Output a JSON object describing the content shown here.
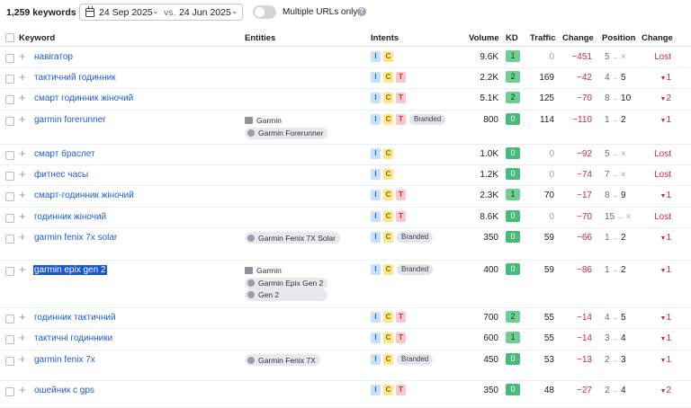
{
  "toolbar": {
    "keyword_count": "1,259 keywords",
    "date_from": "24 Sep 2025",
    "vs": "vs.",
    "date_to": "24 Jun 2025",
    "toggle_label": "Multiple URLs only",
    "help": "?"
  },
  "columns": {
    "keyword": "Keyword",
    "entities": "Entities",
    "intents": "Intents",
    "volume": "Volume",
    "kd": "KD",
    "traffic": "Traffic",
    "change": "Change",
    "position": "Position",
    "pos_change": "Change"
  },
  "rows": [
    {
      "keyword": "навігатор",
      "entities": [],
      "intents": [
        "I",
        "C"
      ],
      "branded": "",
      "volume": "9.6K",
      "kd": "1",
      "traffic": "0",
      "change": "−451",
      "pos_from": "5",
      "pos_to": "×",
      "pos_change": "Lost"
    },
    {
      "keyword": "тактичний годинник",
      "entities": [],
      "intents": [
        "I",
        "C",
        "T"
      ],
      "branded": "",
      "volume": "2.2K",
      "kd": "2",
      "traffic": "169",
      "change": "−42",
      "pos_from": "4",
      "pos_to": "5",
      "pos_change": "1"
    },
    {
      "keyword": "смарт годинник жіночий",
      "entities": [],
      "intents": [
        "I",
        "C",
        "T"
      ],
      "branded": "",
      "volume": "5.1K",
      "kd": "2",
      "traffic": "125",
      "change": "−70",
      "pos_from": "8",
      "pos_to": "10",
      "pos_change": "2"
    },
    {
      "keyword": "garmin forerunner",
      "entities": [
        {
          "icon": "org",
          "label": "Garmin"
        },
        {
          "icon": "gen",
          "label": "Garmin Forerunner",
          "chip": true
        }
      ],
      "intents": [
        "I",
        "C",
        "T"
      ],
      "branded": "Branded",
      "volume": "800",
      "kd": "0",
      "traffic": "114",
      "change": "−110",
      "pos_from": "1",
      "pos_to": "2",
      "pos_change": "1"
    },
    {
      "keyword": "смарт браслет",
      "entities": [],
      "intents": [
        "I",
        "C"
      ],
      "branded": "",
      "volume": "1.0K",
      "kd": "0",
      "traffic": "0",
      "change": "−92",
      "pos_from": "5",
      "pos_to": "×",
      "pos_change": "Lost"
    },
    {
      "keyword": "фитнес часы",
      "entities": [],
      "intents": [
        "I",
        "C"
      ],
      "branded": "",
      "volume": "1.2K",
      "kd": "0",
      "traffic": "0",
      "change": "−74",
      "pos_from": "7",
      "pos_to": "×",
      "pos_change": "Lost"
    },
    {
      "keyword": "смарт-годинник жіночий",
      "entities": [],
      "intents": [
        "I",
        "C",
        "T"
      ],
      "branded": "",
      "volume": "2.3K",
      "kd": "1",
      "traffic": "70",
      "change": "−17",
      "pos_from": "8",
      "pos_to": "9",
      "pos_change": "1"
    },
    {
      "keyword": "годинник жіночий",
      "entities": [],
      "intents": [
        "I",
        "C",
        "T"
      ],
      "branded": "",
      "volume": "8.6K",
      "kd": "0",
      "traffic": "0",
      "change": "−70",
      "pos_from": "15",
      "pos_to": "×",
      "pos_change": "Lost"
    },
    {
      "keyword": "garmin fenix 7x solar",
      "entities": [
        {
          "icon": "gen",
          "label": "Garmin Fenix 7X Solar",
          "chip": true
        }
      ],
      "intents": [
        "I",
        "C"
      ],
      "branded": "Branded",
      "volume": "350",
      "kd": "0",
      "traffic": "59",
      "change": "−66",
      "pos_from": "1",
      "pos_to": "2",
      "pos_change": "1"
    },
    {
      "keyword": "garmin epix gen 2",
      "selected": true,
      "entities": [
        {
          "icon": "org",
          "label": "Garmin"
        },
        {
          "icon": "gen",
          "label": "Garmin Epix Gen 2",
          "chip": true
        },
        {
          "icon": "gen",
          "label": "Gen 2",
          "chip": true
        }
      ],
      "intents": [
        "I",
        "C"
      ],
      "branded": "Branded",
      "volume": "400",
      "kd": "0",
      "traffic": "59",
      "change": "−86",
      "pos_from": "1",
      "pos_to": "2",
      "pos_change": "1"
    },
    {
      "keyword": "годинник тактичний",
      "entities": [],
      "intents": [
        "I",
        "C",
        "T"
      ],
      "branded": "",
      "volume": "700",
      "kd": "2",
      "traffic": "55",
      "change": "−14",
      "pos_from": "4",
      "pos_to": "5",
      "pos_change": "1"
    },
    {
      "keyword": "тактичні годинники",
      "entities": [],
      "intents": [
        "I",
        "C",
        "T"
      ],
      "branded": "",
      "volume": "600",
      "kd": "1",
      "traffic": "55",
      "change": "−14",
      "pos_from": "3",
      "pos_to": "4",
      "pos_change": "1"
    },
    {
      "keyword": "garmin fenix 7x",
      "entities": [
        {
          "icon": "gen",
          "label": "Garmin Fenix 7X",
          "chip": true
        }
      ],
      "intents": [
        "I",
        "C"
      ],
      "branded": "Branded",
      "volume": "450",
      "kd": "0",
      "traffic": "53",
      "change": "−13",
      "pos_from": "2",
      "pos_to": "3",
      "pos_change": "1"
    },
    {
      "keyword": "ошейник с gps",
      "entities": [],
      "intents": [
        "I",
        "C",
        "T"
      ],
      "branded": "",
      "volume": "350",
      "kd": "0",
      "traffic": "48",
      "change": "−27",
      "pos_from": "2",
      "pos_to": "4",
      "pos_change": "2"
    }
  ]
}
